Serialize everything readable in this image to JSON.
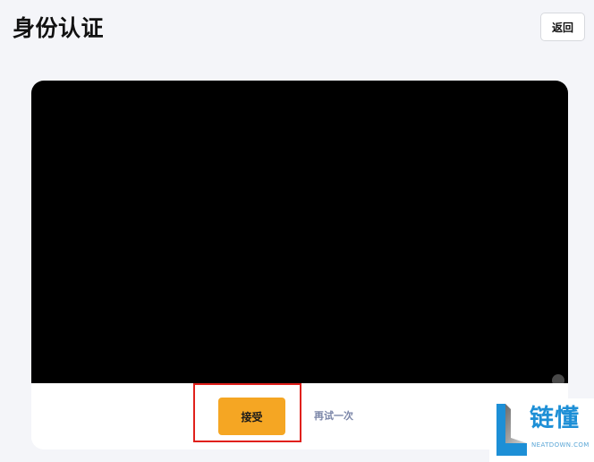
{
  "header": {
    "title": "身份认证",
    "back_label": "返回"
  },
  "camera": {
    "state": "black-preview"
  },
  "actions": {
    "accept_label": "接受",
    "retry_label": "再试一次"
  },
  "watermark": {
    "text": "链懂",
    "subtext": "NEATDOWN.COM",
    "logo_icon": "letter-l-logo"
  },
  "colors": {
    "background": "#f4f5f9",
    "accent": "#f5a623",
    "highlight": "#e0201b",
    "link": "#7b86a8",
    "watermark": "#1d8fd6"
  }
}
